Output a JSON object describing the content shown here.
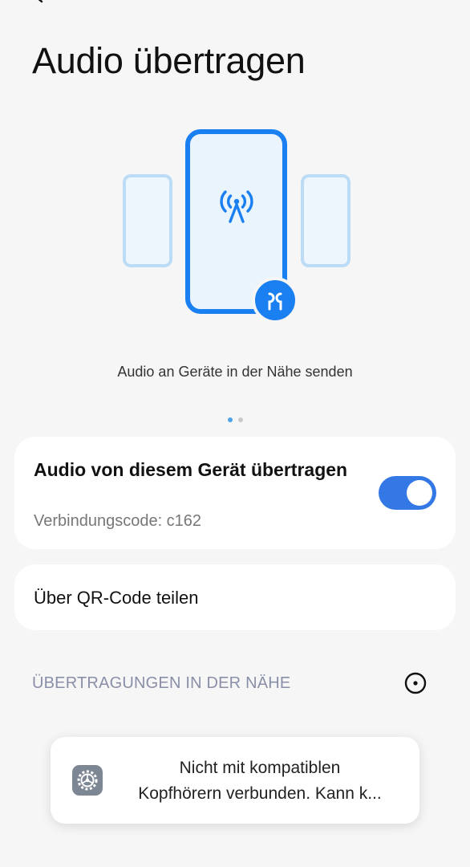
{
  "header": {
    "back_icon": "chevron-left-icon",
    "title": "Audio übertragen"
  },
  "illustration": {
    "caption": "Audio an Geräte in der Nähe senden",
    "center_icon": "broadcast-antenna-icon",
    "badge_icon": "earbuds-icon",
    "accent_color": "#1a7ff0",
    "light_color": "#eaf4fd",
    "side_border_color": "#bcdcf6"
  },
  "pager": {
    "pages": 2,
    "active": 1
  },
  "broadcast_card": {
    "title": "Audio von diesem Gerät übertragen",
    "subtitle": "Verbindungscode: c162",
    "toggle_on": true,
    "toggle_color": "#3478e6"
  },
  "qr_card": {
    "label": "Über QR-Code teilen"
  },
  "nearby": {
    "header": "ÜBERTRAGUNGEN IN DER NÄHE",
    "refresh_icon": "refresh-icon"
  },
  "toast": {
    "icon": "settings-gear-icon",
    "line1": "Nicht mit kompatiblen",
    "line2": "Kopfhörern verbunden. Kann k..."
  }
}
